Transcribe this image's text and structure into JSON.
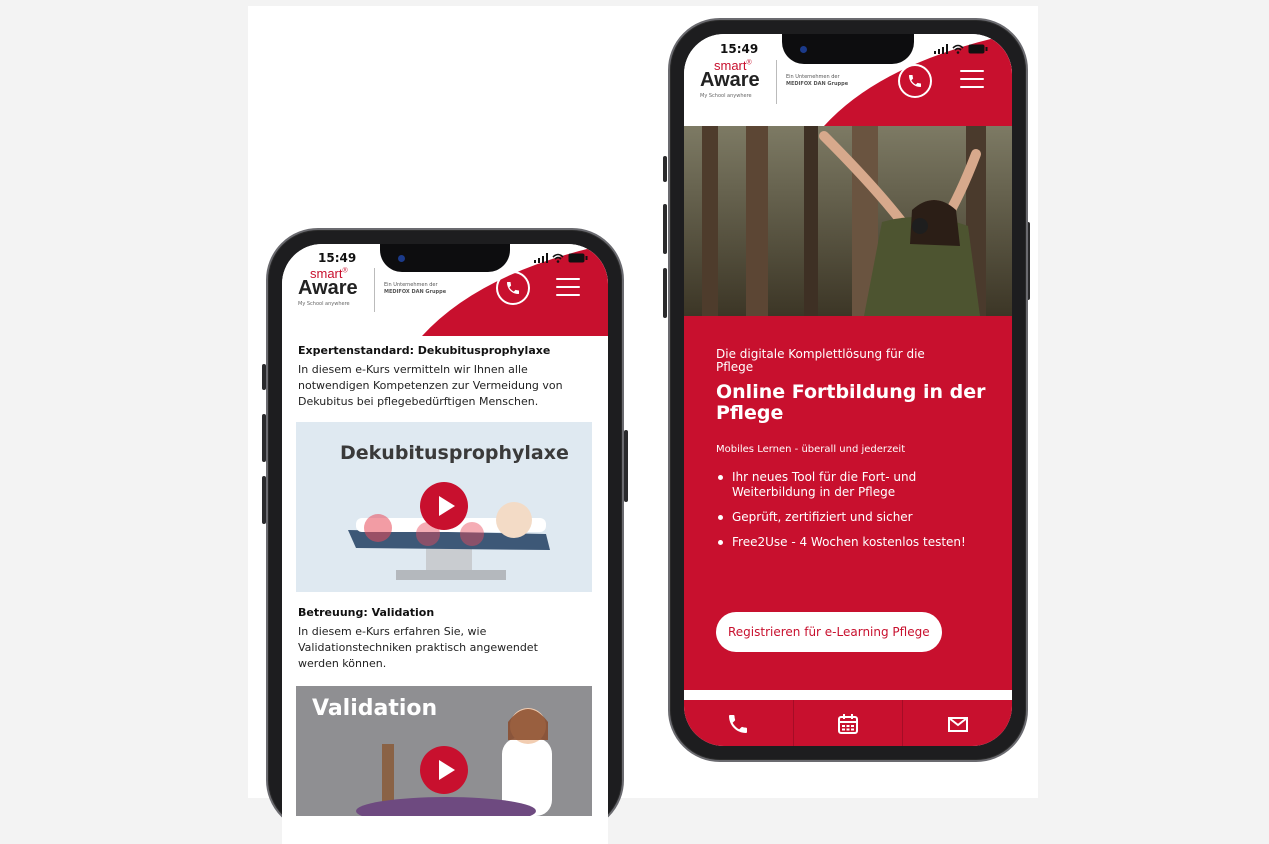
{
  "brand": {
    "logo_smart": "smart",
    "logo_registered": "®",
    "logo_aware": "Aware",
    "tagline": "My School anywhere",
    "company_line1": "Ein Unternehmen der",
    "company_line2": "MEDIFOX DAN Gruppe",
    "accent_color": "#c8102e"
  },
  "status_bar": {
    "time": "15:49"
  },
  "left_phone": {
    "courses": [
      {
        "title": "Expertenstandard: Dekubitusprophylaxe",
        "description": "In diesem e-Kurs vermitteln wir Ihnen alle notwendigen Kompetenzen zur Vermeidung von Dekubitus bei pflegebedürftigen Menschen.",
        "thumbnail_label": "Dekubitusprophylaxe"
      },
      {
        "title": "Betreuung: Validation",
        "description": "In diesem e-Kurs erfahren Sie, wie Validationstechniken praktisch angewendet werden können.",
        "thumbnail_label": "Validation"
      }
    ]
  },
  "right_phone": {
    "subtitle": "Die digitale Komplettlösung für die Pflege",
    "title": "Online Fortbildung in der Pflege",
    "tagline": "Mobiles Lernen - überall und jederzeit",
    "bullets": [
      "Ihr neues Tool für die Fort- und Weiterbildung in der Pflege",
      "Geprüft, zertifiziert und sicher",
      "Free2Use - 4 Wochen kostenlos testen!"
    ],
    "cta_label": "Registrieren für e-Learning Pflege",
    "bottom_nav": [
      "phone-icon",
      "calendar-icon",
      "mail-icon"
    ]
  }
}
